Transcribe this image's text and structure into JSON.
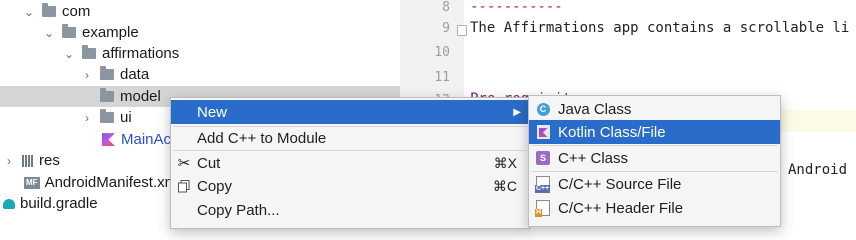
{
  "tree": {
    "items": [
      {
        "label": "com"
      },
      {
        "label": "example"
      },
      {
        "label": "affirmations"
      },
      {
        "label": "data"
      },
      {
        "label": "model"
      },
      {
        "label": "ui"
      },
      {
        "label": "MainAc"
      },
      {
        "label": "res"
      },
      {
        "label": "AndroidManifest.xn",
        "badge": "MF"
      },
      {
        "label": "build.gradle"
      }
    ]
  },
  "editor": {
    "line_numbers": [
      "8",
      "9",
      "10",
      "11",
      "12"
    ],
    "lines": {
      "l8": "-----------",
      "l9": "The Affirmations app contains a scrollable li",
      "l12": "Pre-requisites",
      "l14": "Android"
    }
  },
  "context_menu": {
    "items": [
      {
        "label": "New"
      },
      {
        "label": "Add C++ to Module"
      },
      {
        "label": "Cut",
        "shortcut": "⌘X"
      },
      {
        "label": "Copy",
        "shortcut": "⌘C"
      },
      {
        "label": "Copy Path..."
      }
    ]
  },
  "submenu": {
    "items": [
      {
        "label": "Java Class",
        "icon_text": "C"
      },
      {
        "label": "Kotlin Class/File"
      },
      {
        "label": "C++ Class",
        "icon_text": "S"
      },
      {
        "label": "C/C++ Source File",
        "icon_text": "C++"
      },
      {
        "label": "C/C++ Header File",
        "icon_text": "H"
      }
    ]
  },
  "colors": {
    "selection": "#2a6cc9",
    "tree_selected": "#d5d5d5",
    "link": "#2c50c8"
  }
}
